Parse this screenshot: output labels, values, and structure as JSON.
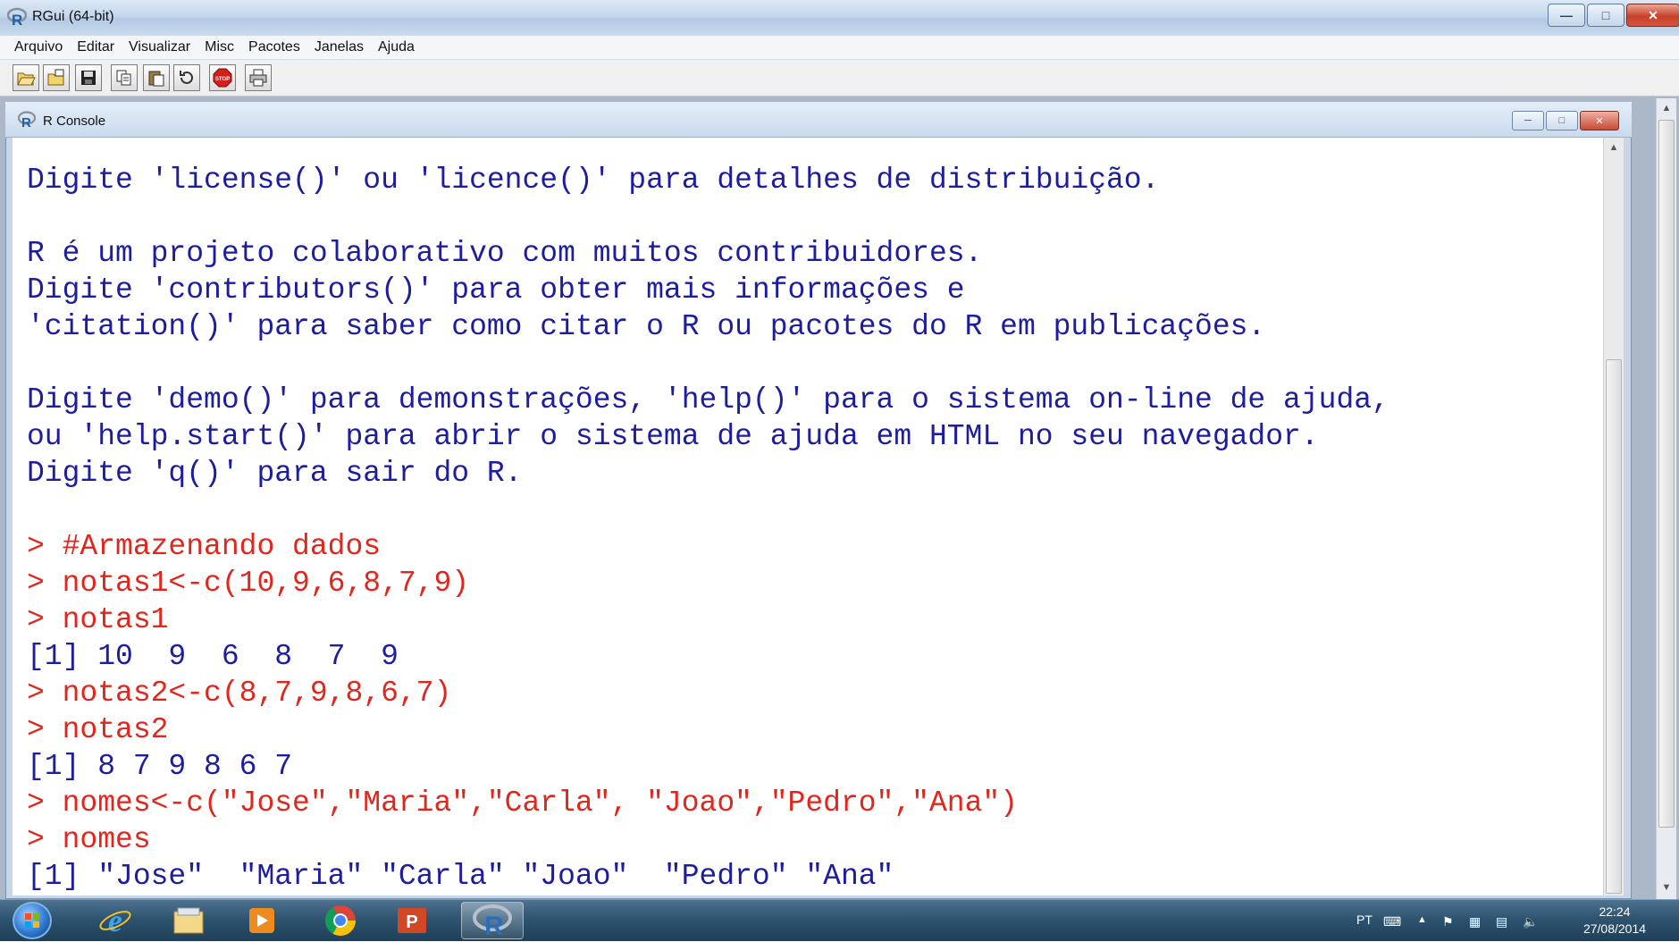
{
  "app": {
    "title": "RGui (64-bit)",
    "menus": [
      "Arquivo",
      "Editar",
      "Visualizar",
      "Misc",
      "Pacotes",
      "Janelas",
      "Ajuda"
    ],
    "toolbar_icons": [
      "open-script-icon",
      "load-workspace-icon",
      "save-workspace-icon",
      "copy-icon",
      "paste-icon",
      "copy-paste-icon",
      "stop-icon",
      "print-icon"
    ]
  },
  "console": {
    "title": "R Console",
    "lines": [
      {
        "text": "Digite 'license()' ou 'licence()' para detalhes de distribuição.",
        "kind": "output"
      },
      {
        "text": "",
        "kind": "blank"
      },
      {
        "text": "R é um projeto colaborativo com muitos contribuidores.",
        "kind": "output"
      },
      {
        "text": "Digite 'contributors()' para obter mais informações e",
        "kind": "output"
      },
      {
        "text": "'citation()' para saber como citar o R ou pacotes do R em publicações.",
        "kind": "output"
      },
      {
        "text": "",
        "kind": "blank"
      },
      {
        "text": "Digite 'demo()' para demonstrações, 'help()' para o sistema on-line de ajuda,",
        "kind": "output"
      },
      {
        "text": "ou 'help.start()' para abrir o sistema de ajuda em HTML no seu navegador.",
        "kind": "output"
      },
      {
        "text": "Digite 'q()' para sair do R.",
        "kind": "output"
      },
      {
        "text": "",
        "kind": "blank"
      },
      {
        "text": "> #Armazenando dados",
        "kind": "input"
      },
      {
        "text": "> notas1<-c(10,9,6,8,7,9)",
        "kind": "input"
      },
      {
        "text": "> notas1",
        "kind": "input"
      },
      {
        "text": "[1] 10  9  6  8  7  9",
        "kind": "output"
      },
      {
        "text": "> notas2<-c(8,7,9,8,6,7)",
        "kind": "input"
      },
      {
        "text": "> notas2",
        "kind": "input"
      },
      {
        "text": "[1] 8 7 9 8 6 7",
        "kind": "output"
      },
      {
        "text": "> nomes<-c(\"Jose\",\"Maria\",\"Carla\", \"Joao\",\"Pedro\",\"Ana\")",
        "kind": "input"
      },
      {
        "text": "> nomes",
        "kind": "input"
      },
      {
        "text": "[1] \"Jose\"  \"Maria\" \"Carla\" \"Joao\"  \"Pedro\" \"Ana\"",
        "kind": "output"
      }
    ],
    "colors": {
      "output": "#1d1d9e",
      "input": "#e0271d"
    }
  },
  "taskbar": {
    "apps": [
      "internet-explorer-icon",
      "file-explorer-icon",
      "media-player-icon",
      "chrome-icon",
      "powerpoint-icon",
      "r-icon"
    ],
    "tray": {
      "language": "PT",
      "time": "22:24",
      "date": "27/08/2014"
    }
  }
}
